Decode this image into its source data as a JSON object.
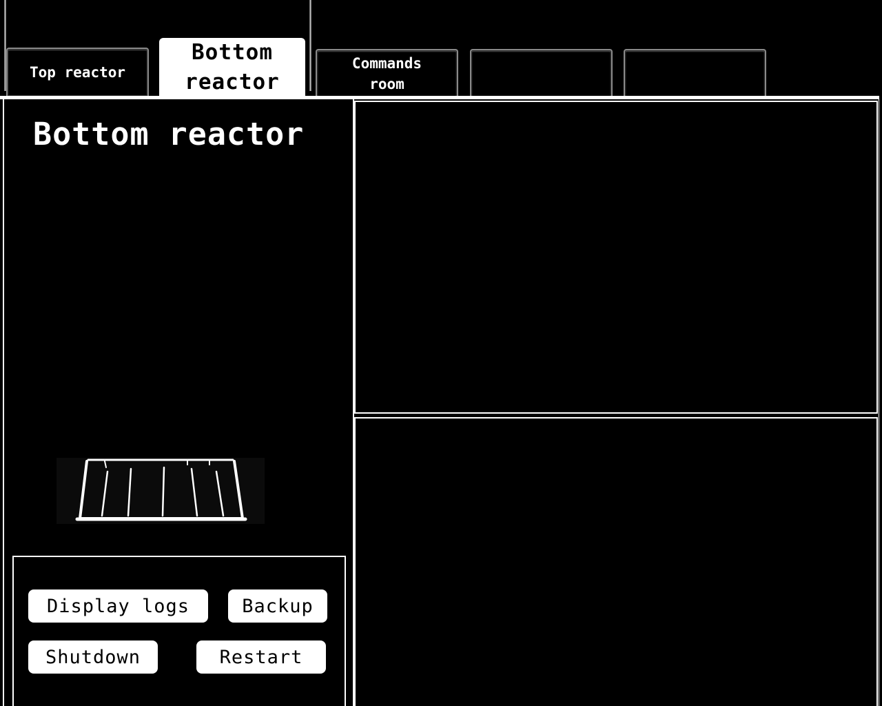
{
  "tabs": {
    "top_reactor": {
      "line1": "Top reactor"
    },
    "bottom_reactor": {
      "line1": "Bottom",
      "line2": "reactor"
    },
    "commands_room": {
      "line1": "Commands",
      "line2": "room"
    },
    "tab4": {
      "line1": ""
    },
    "tab5": {
      "line1": ""
    },
    "active": "bottom_reactor"
  },
  "left_panel": {
    "title": "Bottom reactor"
  },
  "controls": {
    "display_logs": "Display logs",
    "backup": "Backup",
    "shutdown": "Shutdown",
    "restart": "Restart"
  },
  "colors": {
    "background": "#000000",
    "foreground": "#ffffff",
    "tab_border": "#8a8a8a"
  },
  "icons": {
    "reactor_figure": "reactor-core-icon"
  }
}
